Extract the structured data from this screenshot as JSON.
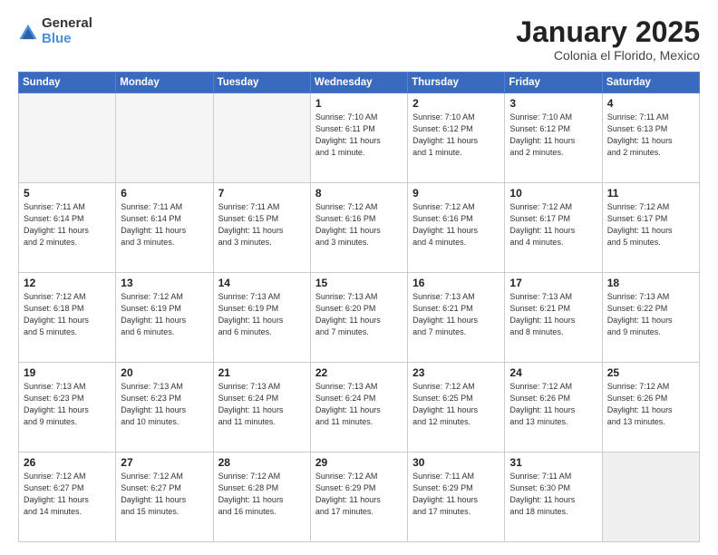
{
  "header": {
    "logo_general": "General",
    "logo_blue": "Blue",
    "title": "January 2025",
    "location": "Colonia el Florido, Mexico"
  },
  "days_of_week": [
    "Sunday",
    "Monday",
    "Tuesday",
    "Wednesday",
    "Thursday",
    "Friday",
    "Saturday"
  ],
  "weeks": [
    [
      {
        "num": "",
        "info": ""
      },
      {
        "num": "",
        "info": ""
      },
      {
        "num": "",
        "info": ""
      },
      {
        "num": "1",
        "info": "Sunrise: 7:10 AM\nSunset: 6:11 PM\nDaylight: 11 hours\nand 1 minute."
      },
      {
        "num": "2",
        "info": "Sunrise: 7:10 AM\nSunset: 6:12 PM\nDaylight: 11 hours\nand 1 minute."
      },
      {
        "num": "3",
        "info": "Sunrise: 7:10 AM\nSunset: 6:12 PM\nDaylight: 11 hours\nand 2 minutes."
      },
      {
        "num": "4",
        "info": "Sunrise: 7:11 AM\nSunset: 6:13 PM\nDaylight: 11 hours\nand 2 minutes."
      }
    ],
    [
      {
        "num": "5",
        "info": "Sunrise: 7:11 AM\nSunset: 6:14 PM\nDaylight: 11 hours\nand 2 minutes."
      },
      {
        "num": "6",
        "info": "Sunrise: 7:11 AM\nSunset: 6:14 PM\nDaylight: 11 hours\nand 3 minutes."
      },
      {
        "num": "7",
        "info": "Sunrise: 7:11 AM\nSunset: 6:15 PM\nDaylight: 11 hours\nand 3 minutes."
      },
      {
        "num": "8",
        "info": "Sunrise: 7:12 AM\nSunset: 6:16 PM\nDaylight: 11 hours\nand 3 minutes."
      },
      {
        "num": "9",
        "info": "Sunrise: 7:12 AM\nSunset: 6:16 PM\nDaylight: 11 hours\nand 4 minutes."
      },
      {
        "num": "10",
        "info": "Sunrise: 7:12 AM\nSunset: 6:17 PM\nDaylight: 11 hours\nand 4 minutes."
      },
      {
        "num": "11",
        "info": "Sunrise: 7:12 AM\nSunset: 6:17 PM\nDaylight: 11 hours\nand 5 minutes."
      }
    ],
    [
      {
        "num": "12",
        "info": "Sunrise: 7:12 AM\nSunset: 6:18 PM\nDaylight: 11 hours\nand 5 minutes."
      },
      {
        "num": "13",
        "info": "Sunrise: 7:12 AM\nSunset: 6:19 PM\nDaylight: 11 hours\nand 6 minutes."
      },
      {
        "num": "14",
        "info": "Sunrise: 7:13 AM\nSunset: 6:19 PM\nDaylight: 11 hours\nand 6 minutes."
      },
      {
        "num": "15",
        "info": "Sunrise: 7:13 AM\nSunset: 6:20 PM\nDaylight: 11 hours\nand 7 minutes."
      },
      {
        "num": "16",
        "info": "Sunrise: 7:13 AM\nSunset: 6:21 PM\nDaylight: 11 hours\nand 7 minutes."
      },
      {
        "num": "17",
        "info": "Sunrise: 7:13 AM\nSunset: 6:21 PM\nDaylight: 11 hours\nand 8 minutes."
      },
      {
        "num": "18",
        "info": "Sunrise: 7:13 AM\nSunset: 6:22 PM\nDaylight: 11 hours\nand 9 minutes."
      }
    ],
    [
      {
        "num": "19",
        "info": "Sunrise: 7:13 AM\nSunset: 6:23 PM\nDaylight: 11 hours\nand 9 minutes."
      },
      {
        "num": "20",
        "info": "Sunrise: 7:13 AM\nSunset: 6:23 PM\nDaylight: 11 hours\nand 10 minutes."
      },
      {
        "num": "21",
        "info": "Sunrise: 7:13 AM\nSunset: 6:24 PM\nDaylight: 11 hours\nand 11 minutes."
      },
      {
        "num": "22",
        "info": "Sunrise: 7:13 AM\nSunset: 6:24 PM\nDaylight: 11 hours\nand 11 minutes."
      },
      {
        "num": "23",
        "info": "Sunrise: 7:12 AM\nSunset: 6:25 PM\nDaylight: 11 hours\nand 12 minutes."
      },
      {
        "num": "24",
        "info": "Sunrise: 7:12 AM\nSunset: 6:26 PM\nDaylight: 11 hours\nand 13 minutes."
      },
      {
        "num": "25",
        "info": "Sunrise: 7:12 AM\nSunset: 6:26 PM\nDaylight: 11 hours\nand 13 minutes."
      }
    ],
    [
      {
        "num": "26",
        "info": "Sunrise: 7:12 AM\nSunset: 6:27 PM\nDaylight: 11 hours\nand 14 minutes."
      },
      {
        "num": "27",
        "info": "Sunrise: 7:12 AM\nSunset: 6:27 PM\nDaylight: 11 hours\nand 15 minutes."
      },
      {
        "num": "28",
        "info": "Sunrise: 7:12 AM\nSunset: 6:28 PM\nDaylight: 11 hours\nand 16 minutes."
      },
      {
        "num": "29",
        "info": "Sunrise: 7:12 AM\nSunset: 6:29 PM\nDaylight: 11 hours\nand 17 minutes."
      },
      {
        "num": "30",
        "info": "Sunrise: 7:11 AM\nSunset: 6:29 PM\nDaylight: 11 hours\nand 17 minutes."
      },
      {
        "num": "31",
        "info": "Sunrise: 7:11 AM\nSunset: 6:30 PM\nDaylight: 11 hours\nand 18 minutes."
      },
      {
        "num": "",
        "info": ""
      }
    ]
  ]
}
